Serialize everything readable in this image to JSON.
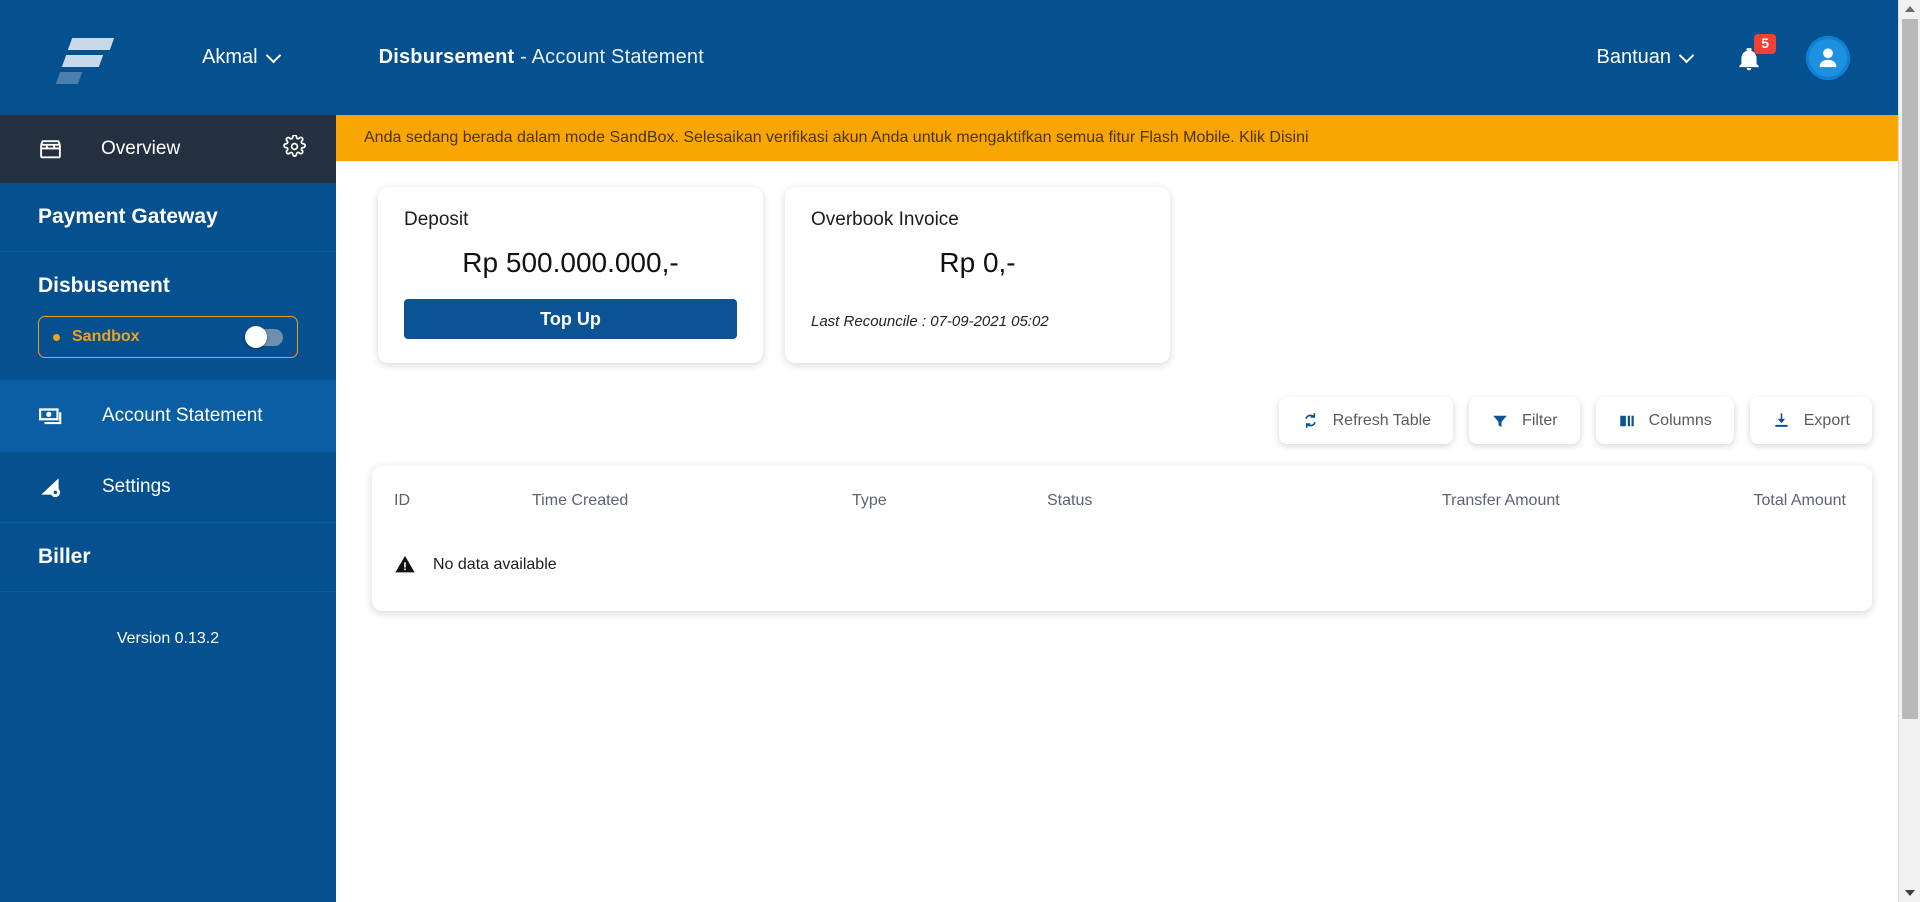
{
  "header": {
    "logo_name": "flash-logo",
    "account_menu": "Akmal",
    "title_bold": "Disbursement",
    "title_rest": " - Account Statement",
    "help_menu": "Bantuan",
    "notification_count": "5",
    "brand_color": "#05508f",
    "accent_color": "#f9a602"
  },
  "sidebar": {
    "overview_label": "Overview",
    "payment_gateway_label": "Payment Gateway",
    "disbursement_label": "Disbusement",
    "sandbox": {
      "label": "Sandbox",
      "enabled": false,
      "border_color": "#e8a317",
      "text_color": "#f0a31a"
    },
    "items": [
      {
        "label": "Account Statement",
        "icon": "money-note-icon",
        "active": true
      },
      {
        "label": "Settings",
        "icon": "chart-gear-icon",
        "active": false
      }
    ],
    "biller_label": "Biller",
    "version": "Version 0.13.2"
  },
  "banner": {
    "text": "Anda sedang berada dalam mode SandBox. Selesaikan verifikasi akun Anda untuk mengaktifkan semua fitur Flash Mobile. Klik Disini",
    "background": "#f9a602"
  },
  "cards": [
    {
      "title": "Deposit",
      "amount": "Rp 500.000.000,-",
      "button_label": "Top Up",
      "subtitle": ""
    },
    {
      "title": "Overbook Invoice",
      "amount": "Rp 0,-",
      "button_label": "",
      "subtitle": "Last Recouncile : 07-09-2021 05:02"
    }
  ],
  "toolbar": {
    "refresh_label": "Refresh Table",
    "filter_label": "Filter",
    "columns_label": "Columns",
    "export_label": "Export"
  },
  "table": {
    "columns": [
      "ID",
      "Time Created",
      "Type",
      "Status",
      "Transfer Amount",
      "Total Amount"
    ],
    "rows": [],
    "empty_message": "No data available"
  }
}
